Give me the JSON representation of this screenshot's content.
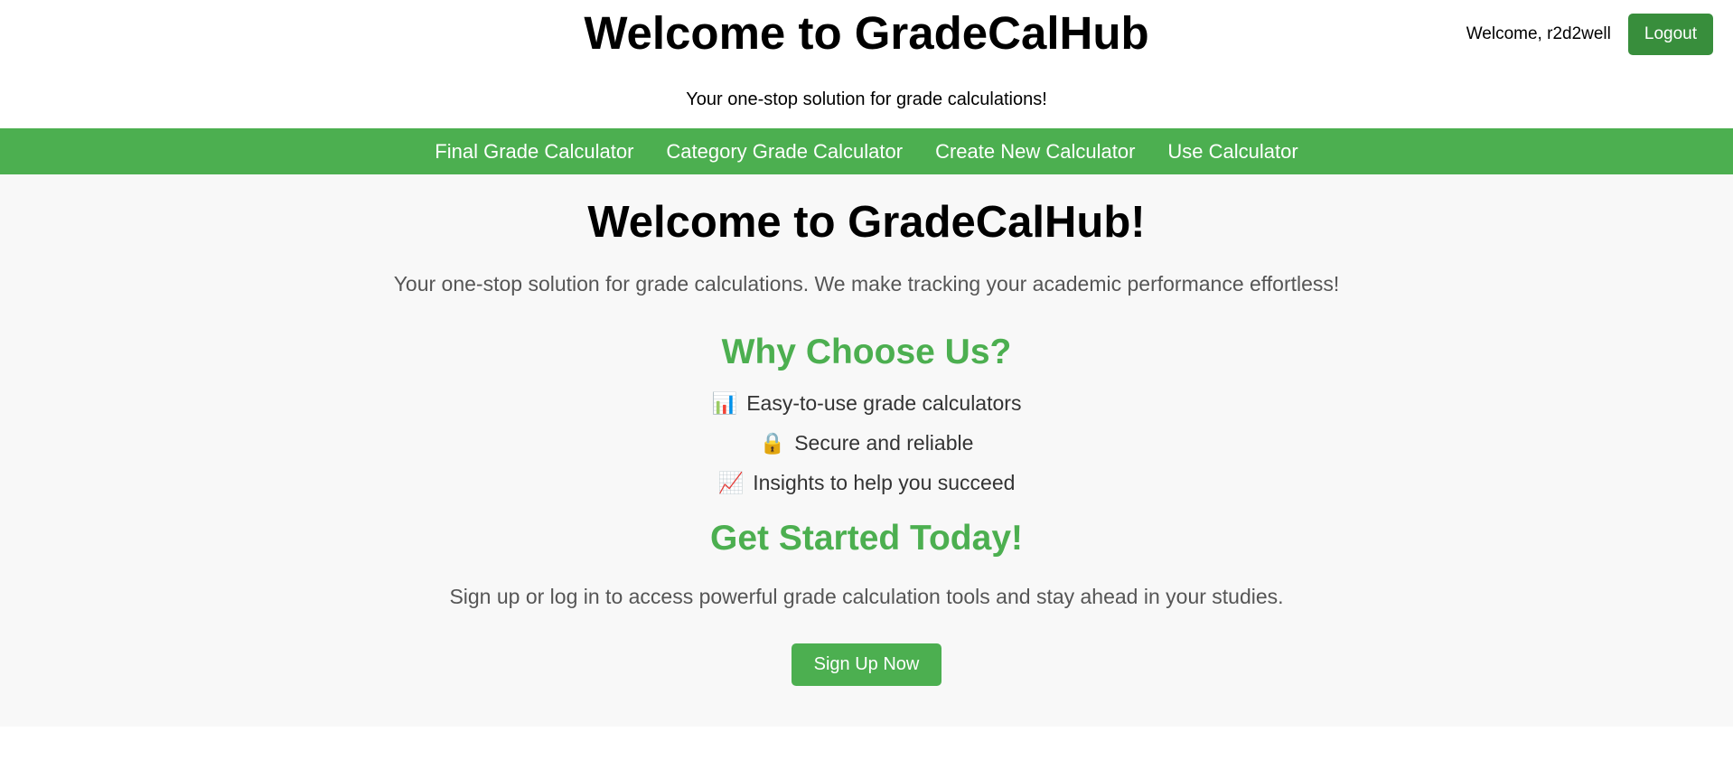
{
  "header": {
    "title": "Welcome to GradeCalHub",
    "tagline": "Your one-stop solution for grade calculations!",
    "welcome_text": "Welcome, r2d2well",
    "logout_label": "Logout"
  },
  "nav": {
    "items": [
      {
        "label": "Final Grade Calculator"
      },
      {
        "label": "Category Grade Calculator"
      },
      {
        "label": "Create New Calculator"
      },
      {
        "label": "Use Calculator"
      }
    ]
  },
  "main": {
    "title": "Welcome to GradeCalHub!",
    "intro": "Your one-stop solution for grade calculations. We make tracking your academic performance effortless!",
    "why_title": "Why Choose Us?",
    "features": [
      {
        "icon": "bar-chart-icon",
        "glyph": "📊",
        "text": "Easy-to-use grade calculators"
      },
      {
        "icon": "lock-icon",
        "glyph": "🔒",
        "text": "Secure and reliable"
      },
      {
        "icon": "chart-increasing-icon",
        "glyph": "📈",
        "text": "Insights to help you succeed"
      }
    ],
    "get_started_title": "Get Started Today!",
    "cta_text": "Sign up or log in to access powerful grade calculation tools and stay ahead in your studies.",
    "signup_label": "Sign Up Now"
  },
  "colors": {
    "brand_green": "#4caf50",
    "logout_green": "#388e3c",
    "main_background": "#f8f8f8"
  }
}
